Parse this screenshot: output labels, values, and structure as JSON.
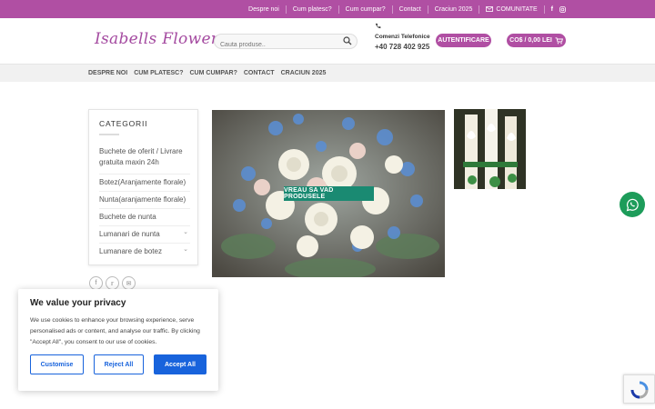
{
  "topbar": {
    "links": [
      "Despre noi",
      "Cum platesc?",
      "Cum cumpar?",
      "Contact",
      "Craciun 2025"
    ],
    "community_label": "COMUNITATE"
  },
  "header": {
    "logo": "Isabells Flowers",
    "search_placeholder": "Cauta produse..",
    "phone_label": "Comenzi Telefonice",
    "phone_number": "+40 728 402 925",
    "auth_button": "AUTENTIFICARE",
    "cart_label": "CO$ / 0,00 LEI"
  },
  "nav": {
    "items": [
      "DESPRE NOI",
      "CUM PLATESC?",
      "CUM CUMPAR?",
      "CONTACT",
      "CRACIUN 2025"
    ]
  },
  "sidebar": {
    "title": "CATEGORII",
    "items": [
      "Buchete de oferit / Livrare gratuita maxin 24h",
      "Botez(Aranjamente florale)",
      "Nunta(aranjamente florale)",
      "Buchete de nunta",
      "Lumanari de nunta",
      "Lumanare de botez"
    ]
  },
  "hero": {
    "button": "VREAU SA VAD PRODUSELE"
  },
  "cookie": {
    "title": "We value your privacy",
    "text": "We use cookies to enhance your browsing experience, serve personalised ads or content, and analyse our traffic. By clicking \"Accept All\", you consent to our use of cookies.",
    "customise": "Customise",
    "reject": "Reject All",
    "accept": "Accept All"
  },
  "colors": {
    "brand": "#b04fa3",
    "hero_button": "#1a8a72",
    "cookie_blue": "#1863dc",
    "whatsapp": "#1d9c5a"
  }
}
